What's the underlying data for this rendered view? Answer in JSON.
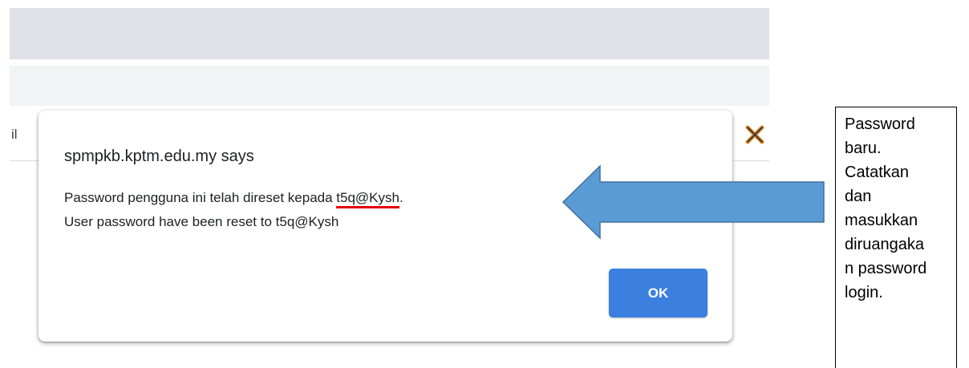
{
  "browser": {
    "partial_page_text": "il"
  },
  "dialog": {
    "title": "spmpkb.kptm.edu.my says",
    "message_line1_prefix": "Password pengguna ini telah direset kepada ",
    "message_line1_password": "t5q@Kysh",
    "message_line1_suffix": ".",
    "message_line2": "User password have been reset to t5q@Kysh",
    "ok_label": "OK"
  },
  "annotation": {
    "arrow_color": "#5b9bd5",
    "note_lines": [
      "Password",
      "baru.",
      "Catatkan",
      "dan",
      "masukkan",
      "diruangaka",
      "n password",
      "login."
    ]
  },
  "colors": {
    "accent": "#3b7fdf",
    "underline": "#e00000"
  }
}
